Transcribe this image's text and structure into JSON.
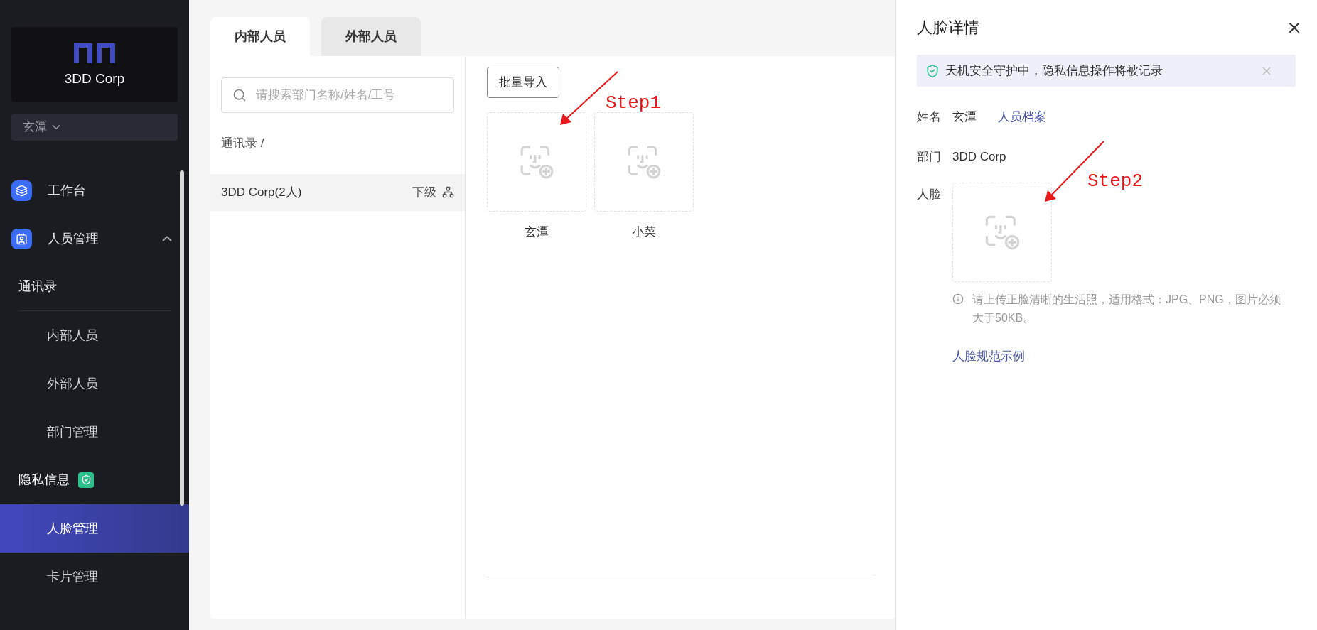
{
  "sidebar": {
    "brand": "3DD Corp",
    "user_menu": "玄潭",
    "nav": [
      {
        "kind": "top",
        "label": "工作台",
        "selected": false
      },
      {
        "kind": "top",
        "label": "人员管理",
        "selected": false,
        "expanded": true
      },
      {
        "kind": "section",
        "label": "通讯录",
        "selected": false
      },
      {
        "kind": "sub",
        "label": "内部人员",
        "selected": false
      },
      {
        "kind": "sub",
        "label": "外部人员",
        "selected": false
      },
      {
        "kind": "sub",
        "label": "部门管理",
        "selected": false
      },
      {
        "kind": "section",
        "label": "隐私信息",
        "selected": false,
        "shield": true
      },
      {
        "kind": "sub",
        "label": "人脸管理",
        "selected": true
      },
      {
        "kind": "sub",
        "label": "卡片管理",
        "selected": false
      }
    ]
  },
  "tabs": [
    {
      "label": "内部人员",
      "selected": true
    },
    {
      "label": "外部人员",
      "selected": false
    }
  ],
  "search": {
    "placeholder": "请搜索部门名称/姓名/工号"
  },
  "breadcrumb": "通讯录 /",
  "departments": [
    {
      "name": "3DD Corp(2人)",
      "sub_label": "下级",
      "selected": true
    }
  ],
  "import_button": "批量导入",
  "people": [
    {
      "name": "玄潭"
    },
    {
      "name": "小菜"
    }
  ],
  "annotations": [
    {
      "label": "Step1"
    },
    {
      "label": "Step2"
    }
  ],
  "drawer": {
    "title": "人脸详情",
    "notice": "天机安全守护中，隐私信息操作将被记录",
    "name_label": "姓名",
    "name_value": "玄潭",
    "profile_link": "人员档案",
    "dept_label": "部门",
    "dept_value": "3DD Corp",
    "face_label": "人脸",
    "hint": "请上传正脸清晰的生活照，适用格式：JPG、PNG，图片必须大于50KB。",
    "example_link": "人脸规范示例"
  }
}
